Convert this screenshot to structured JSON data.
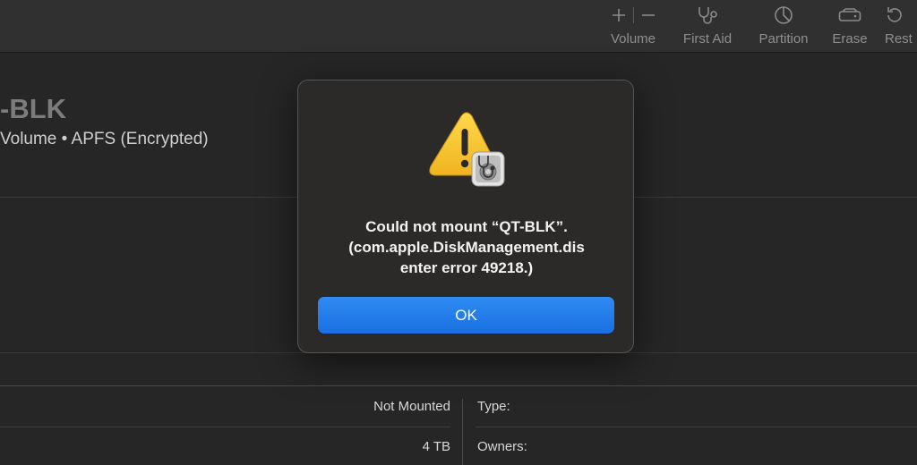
{
  "toolbar": {
    "volume_label": "Volume",
    "first_aid_label": "First Aid",
    "partition_label": "Partition",
    "erase_label": "Erase",
    "restore_label": "Rest"
  },
  "volume": {
    "title": "-BLK",
    "subtitle": "Volume • APFS (Encrypted)"
  },
  "info": {
    "row1_value": "Not Mounted",
    "row1_key": "Type:",
    "row2_value": "4 TB",
    "row2_key": "Owners:"
  },
  "alert": {
    "line1": "Could not mount “QT-BLK”.",
    "line2": "(com.apple.DiskManagement.dis",
    "line3": "enter error 49218.)",
    "ok_label": "OK"
  },
  "colors": {
    "accent": "#1a6fe0",
    "warning": "#f5c431",
    "background": "#262626"
  }
}
